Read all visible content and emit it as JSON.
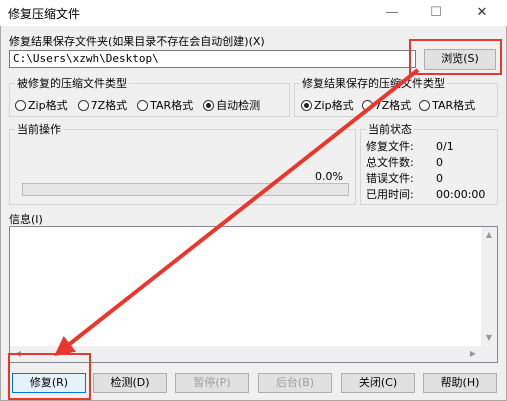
{
  "window": {
    "title": "修复压缩文件",
    "minimize": "—",
    "maximize": "☐",
    "close": "✕"
  },
  "output_path": {
    "label": "修复结果保存文件夹(如果目录不存在会自动创建)(X)",
    "value": "C:\\Users\\xzwh\\Desktop\\",
    "browse_label": "浏览(S)"
  },
  "source_type": {
    "legend": "被修复的压缩文件类型",
    "options": [
      "Zip格式",
      "7Z格式",
      "TAR格式",
      "自动检测"
    ],
    "selected_index": 3
  },
  "result_type": {
    "legend": "修复结果保存的压缩文件类型",
    "options": [
      "Zip格式",
      "7Z格式",
      "TAR格式"
    ],
    "selected_index": 0
  },
  "current_operation": {
    "legend": "当前操作",
    "percent_text": "0.0%",
    "progress": 0
  },
  "current_status": {
    "legend": "当前状态",
    "rows": [
      {
        "label": "修复文件:",
        "value": "0/1"
      },
      {
        "label": "总文件数:",
        "value": "0"
      },
      {
        "label": "错误文件:",
        "value": "0"
      },
      {
        "label": "已用时间:",
        "value": "00:00:00"
      }
    ]
  },
  "info": {
    "label": "信息(I)"
  },
  "buttons": {
    "repair": "修复(R)",
    "detect": "检测(D)",
    "pause": "暂停(P)",
    "background": "后台(B)",
    "close": "关闭(C)",
    "help": "帮助(H)"
  },
  "colors": {
    "annotation": "#e8382e",
    "progress_fill": "#06b025"
  }
}
